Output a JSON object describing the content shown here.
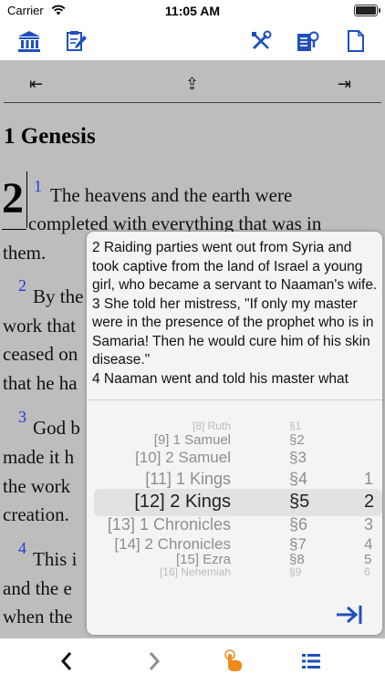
{
  "status": {
    "carrier": "Carrier",
    "time": "11:05 AM"
  },
  "toolbar": {
    "left_icons": [
      "library-icon",
      "notes-icon"
    ],
    "right_icons": [
      "tools-icon",
      "search-doc-icon",
      "page-icon"
    ],
    "accent": "#1f4fbf"
  },
  "nav": {
    "prev": "⇤",
    "up": "⇪",
    "next": "⇥"
  },
  "reader": {
    "book_title": "1 Genesis",
    "chapter": "2",
    "verses": [
      {
        "num": "1",
        "lines": [
          "The heavens and the earth were",
          "completed with everything that was in",
          "them."
        ]
      },
      {
        "num": "2",
        "lines": [
          "By the",
          "work that",
          "ceased on",
          "that he ha"
        ]
      },
      {
        "num": "3",
        "lines": [
          "God b",
          "made it h",
          "the work",
          "creation."
        ]
      },
      {
        "num": "4",
        "lines": [
          "This i",
          "and the e",
          "when the"
        ]
      }
    ]
  },
  "popup": {
    "passage": [
      "2 Raiding parties went out from Syria and took captive from the land of Israel a young girl, who became a servant to Naaman's wife.",
      "3 She told her mistress, \"If only my master were in the presence of the prophet who is in Samaria! Then he would cure him of his skin disease.\"",
      "4 Naaman went and told his master what"
    ],
    "picker": {
      "books": [
        "[8] Ruth",
        "[9] 1 Samuel",
        "[10] 2 Samuel",
        "[11] 1 Kings",
        "[12] 2 Kings",
        "[13] 1 Chronicles",
        "[14] 2 Chronicles",
        "[15] Ezra",
        "[16] Nehemiah"
      ],
      "sections": [
        "§1",
        "§2",
        "§3",
        "§4",
        "§5",
        "§6",
        "§7",
        "§8",
        "§9"
      ],
      "verses": [
        "",
        "",
        "",
        "1",
        "2",
        "3",
        "4",
        "5",
        "6"
      ],
      "selected_index": 4
    },
    "go_icon": "jump-to-icon"
  },
  "bottom_bar": {
    "icons": [
      "back-chevron-icon",
      "forward-chevron-icon",
      "tap-hand-icon",
      "list-icon"
    ],
    "highlight_color": "#f08a1c"
  }
}
